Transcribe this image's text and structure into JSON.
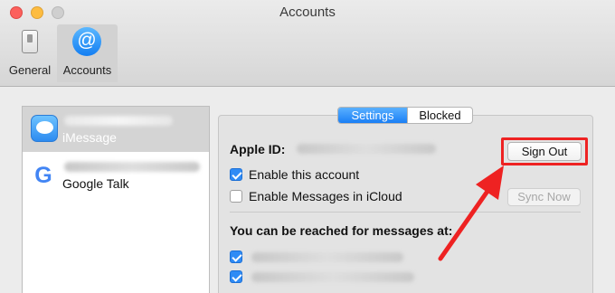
{
  "window": {
    "title": "Accounts"
  },
  "toolbar": {
    "tabs": [
      {
        "label": "General",
        "icon": "switch-icon"
      },
      {
        "label": "Accounts",
        "icon": "at-icon",
        "selected": true
      }
    ]
  },
  "accounts": [
    {
      "name": "iMessage",
      "icon": "imessage-icon",
      "selected": true
    },
    {
      "name": "Google Talk",
      "icon": "google-icon"
    }
  ],
  "detail": {
    "segments": [
      {
        "label": "Settings",
        "selected": true
      },
      {
        "label": "Blocked"
      }
    ],
    "apple_id_label": "Apple ID:",
    "sign_out_label": "Sign Out",
    "enable_account_label": "Enable this account",
    "enable_account_checked": true,
    "icloud_label": "Enable Messages in iCloud",
    "icloud_checked": false,
    "sync_now_label": "Sync Now",
    "reach_label": "You can be reached for messages at:",
    "reach_addresses_checked": [
      true,
      true
    ]
  },
  "annotation": {
    "highlight_color": "#ee2222"
  }
}
